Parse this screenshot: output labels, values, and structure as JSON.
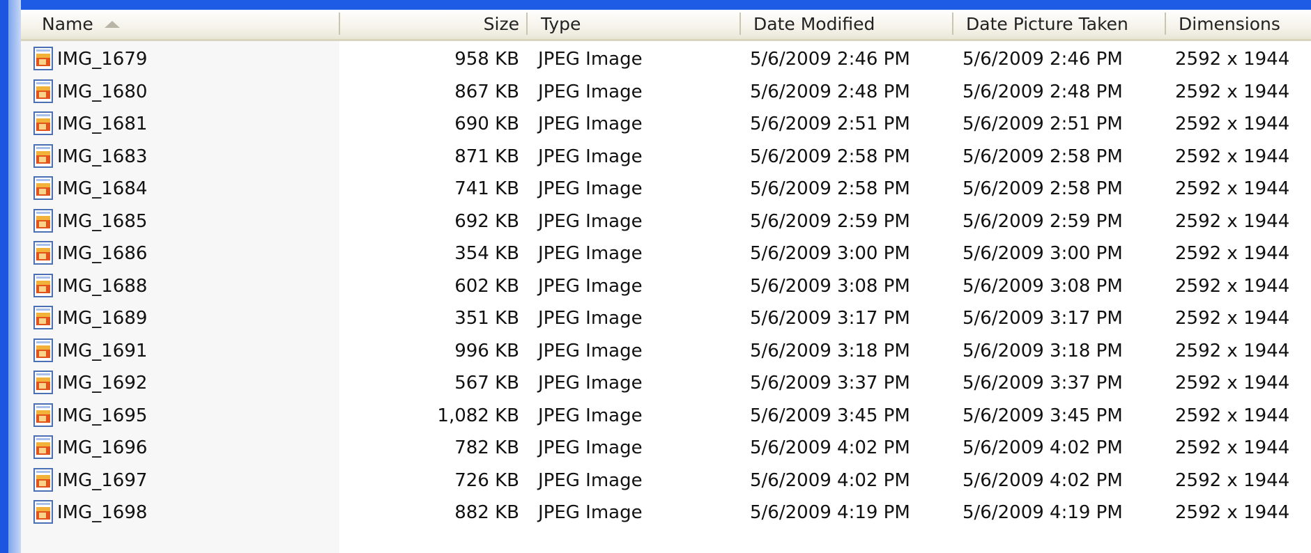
{
  "columns": {
    "name": "Name",
    "size": "Size",
    "type": "Type",
    "date_modified": "Date Modified",
    "date_taken": "Date Picture Taken",
    "dimensions": "Dimensions"
  },
  "sort": {
    "column": "name",
    "direction": "ascending",
    "icon": "sort-ascending-icon"
  },
  "file_icon": "jpeg-file-icon",
  "colors": {
    "desktop_blue": "#1e5ce6",
    "name_column_bg": "#f7f7f7",
    "header_bg": "#f3f1e6"
  },
  "files": [
    {
      "name": "IMG_1679",
      "size": "958 KB",
      "type": "JPEG Image",
      "modified": "5/6/2009 2:46 PM",
      "taken": "5/6/2009 2:46 PM",
      "dimensions": "2592 x 1944"
    },
    {
      "name": "IMG_1680",
      "size": "867 KB",
      "type": "JPEG Image",
      "modified": "5/6/2009 2:48 PM",
      "taken": "5/6/2009 2:48 PM",
      "dimensions": "2592 x 1944"
    },
    {
      "name": "IMG_1681",
      "size": "690 KB",
      "type": "JPEG Image",
      "modified": "5/6/2009 2:51 PM",
      "taken": "5/6/2009 2:51 PM",
      "dimensions": "2592 x 1944"
    },
    {
      "name": "IMG_1683",
      "size": "871 KB",
      "type": "JPEG Image",
      "modified": "5/6/2009 2:58 PM",
      "taken": "5/6/2009 2:58 PM",
      "dimensions": "2592 x 1944"
    },
    {
      "name": "IMG_1684",
      "size": "741 KB",
      "type": "JPEG Image",
      "modified": "5/6/2009 2:58 PM",
      "taken": "5/6/2009 2:58 PM",
      "dimensions": "2592 x 1944"
    },
    {
      "name": "IMG_1685",
      "size": "692 KB",
      "type": "JPEG Image",
      "modified": "5/6/2009 2:59 PM",
      "taken": "5/6/2009 2:59 PM",
      "dimensions": "2592 x 1944"
    },
    {
      "name": "IMG_1686",
      "size": "354 KB",
      "type": "JPEG Image",
      "modified": "5/6/2009 3:00 PM",
      "taken": "5/6/2009 3:00 PM",
      "dimensions": "2592 x 1944"
    },
    {
      "name": "IMG_1688",
      "size": "602 KB",
      "type": "JPEG Image",
      "modified": "5/6/2009 3:08 PM",
      "taken": "5/6/2009 3:08 PM",
      "dimensions": "2592 x 1944"
    },
    {
      "name": "IMG_1689",
      "size": "351 KB",
      "type": "JPEG Image",
      "modified": "5/6/2009 3:17 PM",
      "taken": "5/6/2009 3:17 PM",
      "dimensions": "2592 x 1944"
    },
    {
      "name": "IMG_1691",
      "size": "996 KB",
      "type": "JPEG Image",
      "modified": "5/6/2009 3:18 PM",
      "taken": "5/6/2009 3:18 PM",
      "dimensions": "2592 x 1944"
    },
    {
      "name": "IMG_1692",
      "size": "567 KB",
      "type": "JPEG Image",
      "modified": "5/6/2009 3:37 PM",
      "taken": "5/6/2009 3:37 PM",
      "dimensions": "2592 x 1944"
    },
    {
      "name": "IMG_1695",
      "size": "1,082 KB",
      "type": "JPEG Image",
      "modified": "5/6/2009 3:45 PM",
      "taken": "5/6/2009 3:45 PM",
      "dimensions": "2592 x 1944"
    },
    {
      "name": "IMG_1696",
      "size": "782 KB",
      "type": "JPEG Image",
      "modified": "5/6/2009 4:02 PM",
      "taken": "5/6/2009 4:02 PM",
      "dimensions": "2592 x 1944"
    },
    {
      "name": "IMG_1697",
      "size": "726 KB",
      "type": "JPEG Image",
      "modified": "5/6/2009 4:02 PM",
      "taken": "5/6/2009 4:02 PM",
      "dimensions": "2592 x 1944"
    },
    {
      "name": "IMG_1698",
      "size": "882 KB",
      "type": "JPEG Image",
      "modified": "5/6/2009 4:19 PM",
      "taken": "5/6/2009 4:19 PM",
      "dimensions": "2592 x 1944"
    }
  ]
}
